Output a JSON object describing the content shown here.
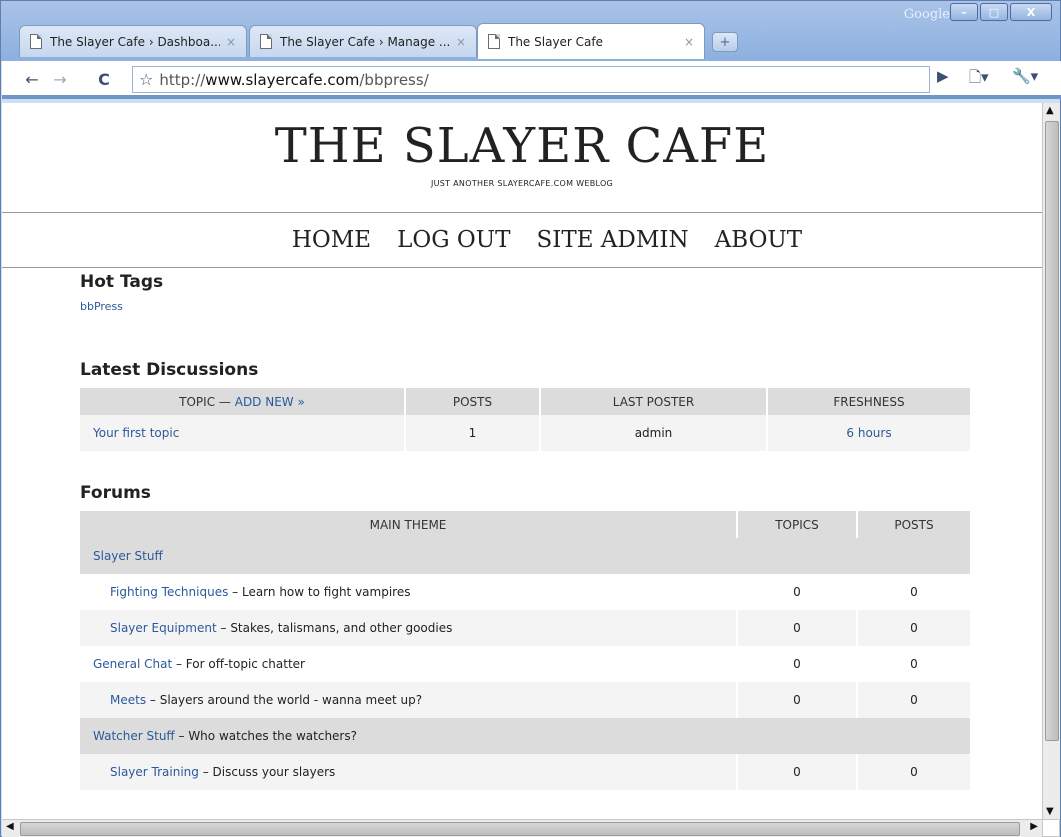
{
  "window": {
    "google_label": "Google",
    "buttons": [
      "–",
      "□",
      "X"
    ]
  },
  "tabs": [
    {
      "title": "The Slayer Cafe › Dashboa...",
      "close": "×"
    },
    {
      "title": "The Slayer Cafe › Manage ...",
      "close": "×"
    },
    {
      "title": "The Slayer Cafe",
      "close": "×"
    }
  ],
  "toolbar": {
    "back_icon": "←",
    "forward_icon": "→",
    "reload_icon": "C",
    "star_icon": "☆",
    "url_prefix": "http://",
    "url_host": "www.slayercafe.com",
    "url_path": "/bbpress/",
    "go_icon": "▶",
    "page_menu_icon": "🗋▾",
    "wrench_icon": "🔧▾"
  },
  "site": {
    "title": "THE SLAYER CAFE",
    "tagline": "JUST ANOTHER SLAYERCAFE.COM WEBLOG",
    "nav": [
      "HOME",
      "LOG OUT",
      "SITE ADMIN",
      "ABOUT"
    ]
  },
  "hot_tags": {
    "heading": "Hot Tags",
    "tags": [
      "bbPress"
    ]
  },
  "latest": {
    "heading": "Latest Discussions",
    "columns": {
      "topic": "TOPIC —",
      "add_new": "ADD NEW »",
      "posts": "POSTS",
      "last_poster": "LAST POSTER",
      "freshness": "FRESHNESS"
    },
    "rows": [
      {
        "topic": "Your first topic",
        "posts": "1",
        "last_poster": "admin",
        "freshness": "6 hours"
      }
    ]
  },
  "forums": {
    "heading": "Forums",
    "columns": {
      "main_theme": "MAIN THEME",
      "topics": "TOPICS",
      "posts": "POSTS"
    },
    "rows": [
      {
        "name": "Slayer Stuff",
        "desc": "",
        "topics": "",
        "posts": ""
      },
      {
        "name": "Fighting Techniques",
        "desc": " – Learn how to fight vampires",
        "topics": "0",
        "posts": "0"
      },
      {
        "name": "Slayer Equipment",
        "desc": " – Stakes, talismans, and other goodies",
        "topics": "0",
        "posts": "0"
      },
      {
        "name": "General Chat",
        "desc": " – For off-topic chatter",
        "topics": "0",
        "posts": "0"
      },
      {
        "name": "Meets",
        "desc": " – Slayers around the world - wanna meet up?",
        "topics": "0",
        "posts": "0"
      },
      {
        "name": "Watcher Stuff",
        "desc": " – Who watches the watchers?",
        "topics": "",
        "posts": ""
      },
      {
        "name": "Slayer Training",
        "desc": " – Discuss your slayers",
        "topics": "0",
        "posts": "0"
      }
    ]
  }
}
